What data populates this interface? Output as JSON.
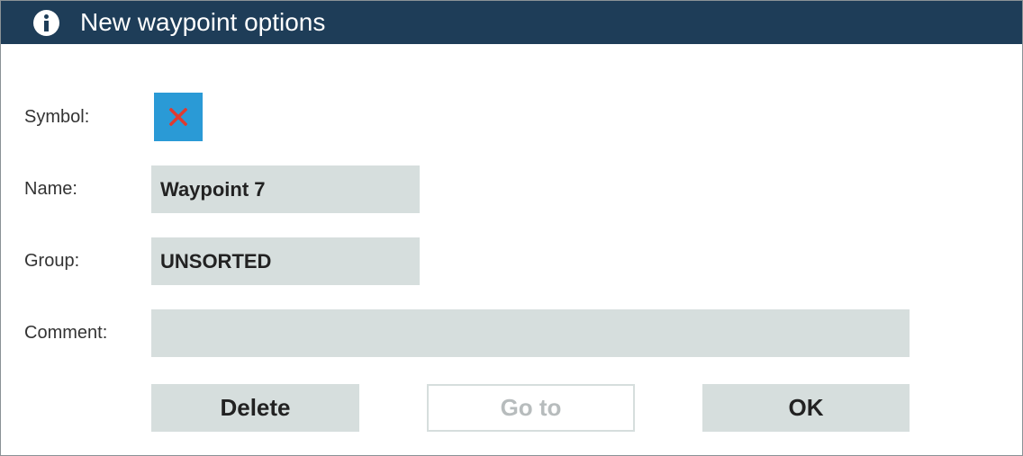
{
  "dialog": {
    "title": "New waypoint options",
    "icon": "info-icon",
    "accent_color": "#1e3d58"
  },
  "fields": {
    "symbol_label": "Symbol:",
    "symbol_icon": "x-mark-icon",
    "symbol_bg_color": "#2a9ad6",
    "symbol_mark_color": "#e03a2f",
    "name_label": "Name:",
    "name_value": "Waypoint 7",
    "group_label": "Group:",
    "group_value": "UNSORTED",
    "comment_label": "Comment:",
    "comment_value": ""
  },
  "buttons": {
    "delete": "Delete",
    "goto": "Go to",
    "ok": "OK"
  }
}
